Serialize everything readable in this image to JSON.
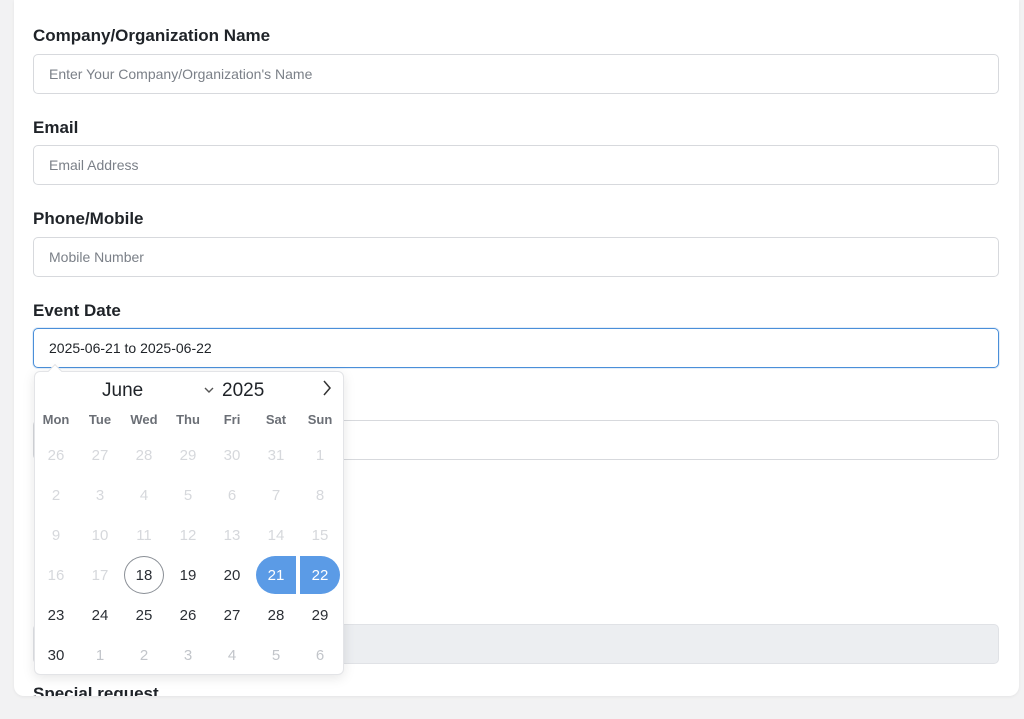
{
  "form": {
    "company": {
      "label": "Company/Organization Name",
      "placeholder": "Enter Your Company/Organization's Name"
    },
    "email": {
      "label": "Email",
      "placeholder": "Email Address"
    },
    "phone": {
      "label": "Phone/Mobile",
      "placeholder": "Mobile Number"
    },
    "event_date": {
      "label": "Event Date",
      "value": "2025-06-21 to 2025-06-22"
    },
    "special_request": {
      "label": "Special request"
    }
  },
  "calendar": {
    "month": "June",
    "year": "2025",
    "weekdays": [
      "Mon",
      "Tue",
      "Wed",
      "Thu",
      "Fri",
      "Sat",
      "Sun"
    ],
    "weeks": [
      [
        "26",
        "27",
        "28",
        "29",
        "30",
        "31",
        "1"
      ],
      [
        "2",
        "3",
        "4",
        "5",
        "6",
        "7",
        "8"
      ],
      [
        "9",
        "10",
        "11",
        "12",
        "13",
        "14",
        "15"
      ],
      [
        "16",
        "17",
        "18",
        "19",
        "20",
        "21",
        "22"
      ],
      [
        "23",
        "24",
        "25",
        "26",
        "27",
        "28",
        "29"
      ],
      [
        "30",
        "1",
        "2",
        "3",
        "4",
        "5",
        "6"
      ]
    ],
    "today": "18",
    "range_start": "21",
    "range_end": "22",
    "accent_color": "#5b9be6"
  }
}
